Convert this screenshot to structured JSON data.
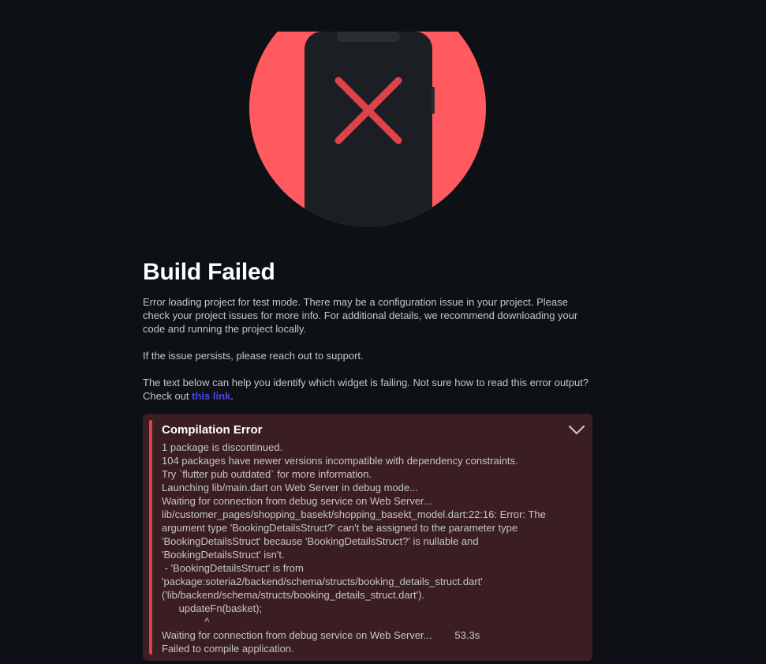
{
  "hero": {
    "illustration_icon": "phone-with-x-icon",
    "colors": {
      "circle": "#ff5a5f",
      "phone_body": "#1b1e22",
      "x_mark": "#e0424a"
    }
  },
  "main": {
    "title": "Build Failed",
    "paragraph1": "Error loading project for test mode. There may be a configuration issue in your project. Please check your project issues for more info. For additional details, we recommend downloading your code and running the project locally.",
    "paragraph2": "If the issue persists, please reach out to support.",
    "paragraph3_prefix": "The text below can help you identify which widget is failing. Not sure how to read this error output? Check out ",
    "link_text": "this link",
    "paragraph3_suffix": ".",
    "link_color": "#4b45ea"
  },
  "error_panel": {
    "title": "Compilation Error",
    "toggle_icon": "chevron-down-icon",
    "accent_color": "#e0424a",
    "log": "1 package is discontinued.\n104 packages have newer versions incompatible with dependency constraints.\nTry `flutter pub outdated` for more information.\nLaunching lib/main.dart on Web Server in debug mode...\nWaiting for connection from debug service on Web Server...\nlib/customer_pages/shopping_basekt/shopping_basekt_model.dart:22:16: Error: The argument type 'BookingDetailsStruct?' can't be assigned to the parameter type 'BookingDetailsStruct' because 'BookingDetailsStruct?' is nullable and 'BookingDetailsStruct' isn't.\n - 'BookingDetailsStruct' is from 'package:soteria2/backend/schema/structs/booking_details_struct.dart' ('lib/backend/schema/structs/booking_details_struct.dart').\n      updateFn(basket);\n               ^\nWaiting for connection from debug service on Web Server...        53.3s\nFailed to compile application."
  }
}
